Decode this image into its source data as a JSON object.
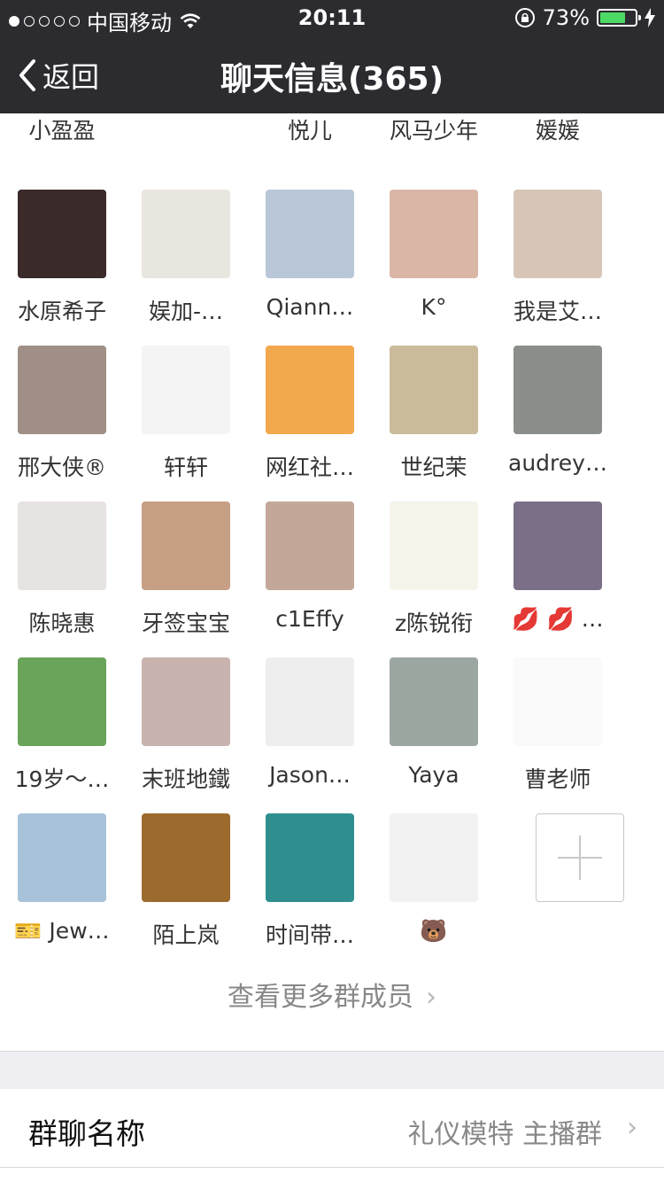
{
  "status_bar": {
    "carrier": "中国移动",
    "time": "20:11",
    "battery": "73%",
    "battery_level": 0.73
  },
  "nav": {
    "back_label": "返回",
    "title": "聊天信息(365)"
  },
  "members_top_partial": [
    "小盈盈",
    "",
    "悦儿",
    "风马少年",
    "媛媛"
  ],
  "members": [
    {
      "name": "水原希子",
      "color": "#3a2a2a"
    },
    {
      "name": "娱加-…",
      "color": "#e9e6df"
    },
    {
      "name": "Qiann…",
      "color": "#b9c7d8"
    },
    {
      "name": "K°",
      "color": "#d9b6a5"
    },
    {
      "name": "我是艾…",
      "color": "#d7c6b8"
    },
    {
      "name": "邢大侠®",
      "color": "#9f8f86"
    },
    {
      "name": "轩轩",
      "color": "#f4f4f4"
    },
    {
      "name": "网红社…",
      "color": "#f2a84c"
    },
    {
      "name": "世纪茉",
      "color": "#cabb9b"
    },
    {
      "name": "audrey…",
      "color": "#8a8f8a"
    },
    {
      "name": "陈晓惠",
      "color": "#e7e3e1"
    },
    {
      "name": "牙签宝宝",
      "color": "#c69f85"
    },
    {
      "name": "c1Effy",
      "color": "#c3a89a"
    },
    {
      "name": "z陈锐衔",
      "color": "#f6f3e9"
    },
    {
      "name": "💋 💋 …",
      "color": "#7b6f88"
    },
    {
      "name": "19岁～…",
      "color": "#6aa45a"
    },
    {
      "name": "末班地鐵",
      "color": "#c9b3ae"
    },
    {
      "name": "Jason…",
      "color": "#eeeeee"
    },
    {
      "name": "Yaya",
      "color": "#9ca7a2"
    },
    {
      "name": "曹老师",
      "color": "#fafafa"
    },
    {
      "name": "🎫 Jew…",
      "color": "#a8c2da"
    },
    {
      "name": "陌上岚",
      "color": "#9c6a2c"
    },
    {
      "name": "时间带…",
      "color": "#2f8f8f"
    },
    {
      "name": "🐻",
      "color": "#f2f2f2"
    }
  ],
  "more_members_label": "查看更多群成员",
  "group_name_row": {
    "label": "群聊名称",
    "value": "礼仪模特 主播群"
  },
  "colors": {
    "nav_bg": "#2c2b30",
    "battery_green": "#4cd964",
    "separator_bg": "#efeff4"
  }
}
